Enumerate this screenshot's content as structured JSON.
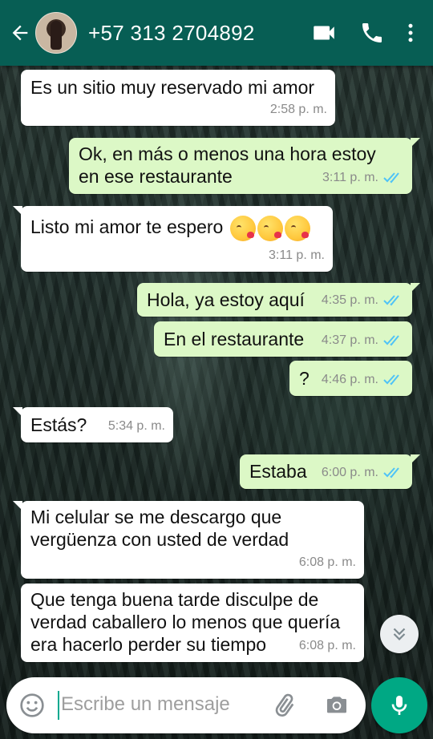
{
  "header": {
    "contact_name": "+57 313 2704892"
  },
  "messages": [
    {
      "dir": "in",
      "text": "Es un sitio muy reservado mi amor",
      "time": "2:58 p. m."
    },
    {
      "dir": "out",
      "line1": "Ok, en más o menos una hora estoy",
      "line2": "en ese restaurante",
      "time": "3:11 p. m.",
      "status": "read"
    },
    {
      "dir": "in",
      "text": "Listo mi amor te espero",
      "emojis": [
        "kissing-heart-emoji",
        "kissing-heart-emoji",
        "kissing-heart-emoji"
      ],
      "time": "3:11 p. m."
    },
    {
      "dir": "out",
      "text": "Hola, ya estoy aquí",
      "time": "4:35 p. m.",
      "status": "read"
    },
    {
      "dir": "out",
      "text": "En el restaurante",
      "time": "4:37 p. m.",
      "status": "read"
    },
    {
      "dir": "out",
      "text": "?",
      "time": "4:46 p. m.",
      "status": "read"
    },
    {
      "dir": "in",
      "text": "Estás?",
      "time": "5:34 p. m."
    },
    {
      "dir": "out",
      "text": "Estaba",
      "time": "6:00 p. m.",
      "status": "read"
    },
    {
      "dir": "in",
      "line1": "Mi celular se me descargo que",
      "line2": "vergüenza con usted de verdad",
      "time": "6:08 p. m."
    },
    {
      "dir": "in",
      "line1": "Que tenga buena tarde disculpe de",
      "line2": "verdad caballero lo menos que quería",
      "line3": "era hacerlo perder su tiempo",
      "time": "6:08 p. m."
    }
  ],
  "composer": {
    "placeholder": "Escribe un mensaje"
  },
  "colors": {
    "header": "#075e54",
    "outgoing_bubble": "#dcf8c6",
    "incoming_bubble": "#ffffff",
    "read_ticks": "#4fc3f7",
    "fab": "#00a884"
  },
  "icons": {
    "back": "arrow-left-icon",
    "video": "video-call-icon",
    "call": "phone-icon",
    "menu": "more-vert-icon",
    "scroll": "double-chevron-down-icon",
    "emoji": "emoji-icon",
    "attach": "paperclip-icon",
    "camera": "camera-icon",
    "mic": "microphone-icon"
  }
}
